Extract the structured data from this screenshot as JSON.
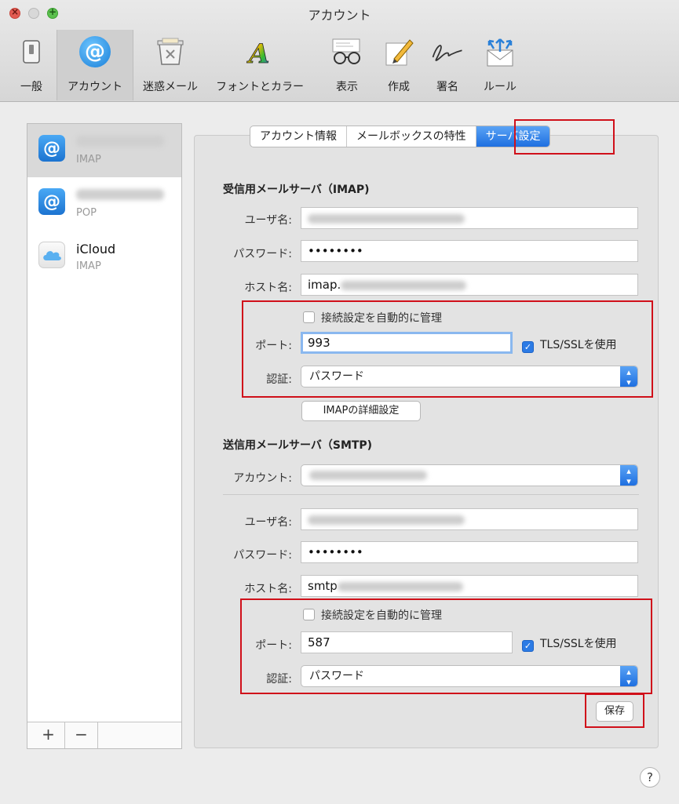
{
  "window": {
    "title": "アカウント"
  },
  "toolbar": {
    "items": [
      {
        "label": "一般",
        "icon": "switch-icon"
      },
      {
        "label": "アカウント",
        "icon": "at-icon",
        "selected": true
      },
      {
        "label": "迷惑メール",
        "icon": "junk-trash-icon"
      },
      {
        "label": "フォントとカラー",
        "icon": "font-a-icon"
      },
      {
        "label": "表示",
        "icon": "glasses-icon"
      },
      {
        "label": "作成",
        "icon": "pencil-icon"
      },
      {
        "label": "署名",
        "icon": "signature-icon"
      },
      {
        "label": "ルール",
        "icon": "rules-envelope-icon"
      }
    ]
  },
  "sidebar": {
    "accounts": [
      {
        "name": "",
        "type": "IMAP",
        "icon": "at-icon",
        "selected": true
      },
      {
        "name": "",
        "type": "POP",
        "icon": "at-icon"
      },
      {
        "name": "iCloud",
        "type": "IMAP",
        "icon": "icloud-icon"
      }
    ],
    "add_label": "+",
    "remove_label": "−"
  },
  "tabs": [
    {
      "label": "アカウント情報"
    },
    {
      "label": "メールボックスの特性"
    },
    {
      "label": "サーバ設定",
      "active": true
    }
  ],
  "incoming": {
    "title": "受信用メールサーバ（IMAP)",
    "username_label": "ユーザ名:",
    "username_value": "",
    "password_label": "パスワード:",
    "password_value": "••••••••",
    "host_label": "ホスト名:",
    "host_value": "imap.",
    "auto_manage_label": "接続設定を自動的に管理",
    "auto_manage_checked": false,
    "port_label": "ポート:",
    "port_value": "993",
    "tls_label": "TLS/SSLを使用",
    "tls_checked": true,
    "auth_label": "認証:",
    "auth_value": "パスワード",
    "advanced_button": "IMAPの詳細設定"
  },
  "outgoing": {
    "title": "送信用メールサーバ（SMTP)",
    "account_label": "アカウント:",
    "account_value": "",
    "username_label": "ユーザ名:",
    "username_value": "",
    "password_label": "パスワード:",
    "password_value": "••••••••",
    "host_label": "ホスト名:",
    "host_value": "smtp",
    "auto_manage_label": "接続設定を自動的に管理",
    "auto_manage_checked": false,
    "port_label": "ポート:",
    "port_value": "587",
    "tls_label": "TLS/SSLを使用",
    "tls_checked": true,
    "auth_label": "認証:",
    "auth_value": "パスワード",
    "save_button": "保存"
  },
  "help": {
    "label": "?"
  },
  "colors": {
    "highlight_box": "#d0101a",
    "accent": "#1e6fe0"
  }
}
